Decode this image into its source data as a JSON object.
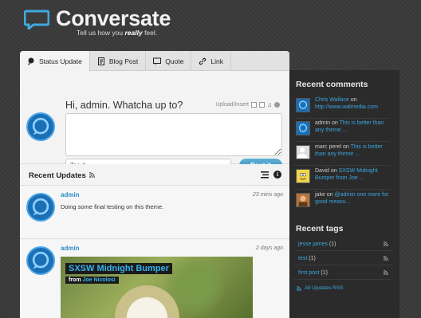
{
  "header": {
    "logo_text": "Conversate",
    "tagline_prefix": "Tell us how you ",
    "tagline_em": "really",
    "tagline_suffix": " feel."
  },
  "tabs": [
    {
      "label": "Status Update",
      "icon": "status-icon",
      "active": true
    },
    {
      "label": "Blog Post",
      "icon": "blog-post-icon",
      "active": false
    },
    {
      "label": "Quote",
      "icon": "quote-icon",
      "active": false
    },
    {
      "label": "Link",
      "icon": "link-icon",
      "active": false
    }
  ],
  "composer": {
    "prompt": "Hi, admin. Whatcha up to?",
    "upload_label": "Upload/Insert",
    "post_text_placeholder": "",
    "tag_placeholder": "Tag it",
    "post_button": "Post it"
  },
  "updates": {
    "title": "Recent Updates",
    "posts": [
      {
        "author": "admin",
        "time": "23 mins ago",
        "body": "Doing some final testing on this theme."
      },
      {
        "author": "admin",
        "time": "2 days ago",
        "image_title": "SXSW Midnight Bumper",
        "image_from": "from ",
        "image_from_name": "Joe Nicolosi"
      }
    ]
  },
  "sidebar": {
    "comments_title": "Recent comments",
    "comments": [
      {
        "author": "Chris Wallace",
        "mid": " on ",
        "link": "http://www.walmedia.com",
        "avatar": "blue-logo"
      },
      {
        "author": "admin",
        "mid": " on ",
        "link": "This is better than any theme ...",
        "avatar": "blue-logo"
      },
      {
        "author": "marc perel",
        "mid": " on ",
        "link": "This is better than any theme ...",
        "avatar": "default"
      },
      {
        "author": "David",
        "mid": " on ",
        "link": "SXSW Midnight Bumper from Joe ...",
        "avatar": "homer"
      },
      {
        "author": "jake",
        "mid": " on ",
        "link": "@admin one more for good measu...",
        "avatar": "photo"
      }
    ],
    "tags_title": "Recent tags",
    "tags": [
      {
        "name": "jesse james",
        "count": "(1)"
      },
      {
        "name": "test",
        "count": "(1)"
      },
      {
        "name": "first post",
        "count": "(1)"
      }
    ],
    "all_rss": "All Updates RSS"
  },
  "colors": {
    "accent": "#2a8cc7",
    "link": "#3aa6e0",
    "sidebar_bg": "#2b2b2b"
  }
}
